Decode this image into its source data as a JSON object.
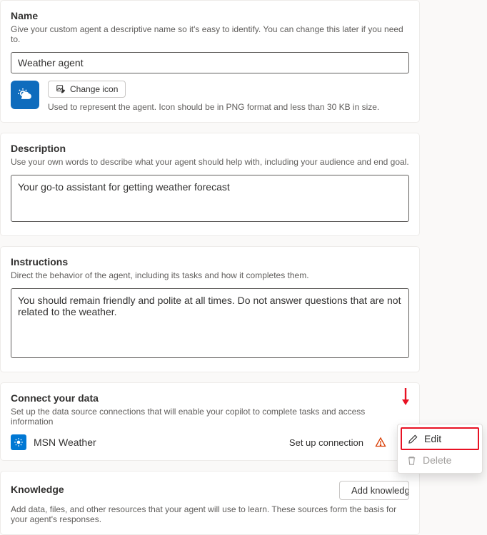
{
  "name_section": {
    "title": "Name",
    "help": "Give your custom agent a descriptive name so it's easy to identify. You can change this later if you need to.",
    "value": "Weather agent",
    "change_icon_label": "Change icon",
    "icon_help": "Used to represent the agent. Icon should be in PNG format and less than 30 KB in size."
  },
  "description_section": {
    "title": "Description",
    "help": "Use your own words to describe what your agent should help with, including your audience and end goal.",
    "value": "Your go-to assistant for getting weather forecast"
  },
  "instructions_section": {
    "title": "Instructions",
    "help": "Direct the behavior of the agent, including its tasks and how it completes them.",
    "value": "You should remain friendly and polite at all times. Do not answer questions that are not related to the weather."
  },
  "data_section": {
    "title": "Connect your data",
    "help": "Set up the data source connections that will enable your copilot to complete tasks and access information",
    "item": {
      "name": "MSN Weather",
      "status": "Set up connection"
    }
  },
  "knowledge_section": {
    "title": "Knowledge",
    "add_label": "Add knowledge",
    "help": "Add data, files, and other resources that your agent will use to learn. These sources form the basis for your agent's responses."
  },
  "context_menu": {
    "edit": "Edit",
    "delete": "Delete"
  }
}
